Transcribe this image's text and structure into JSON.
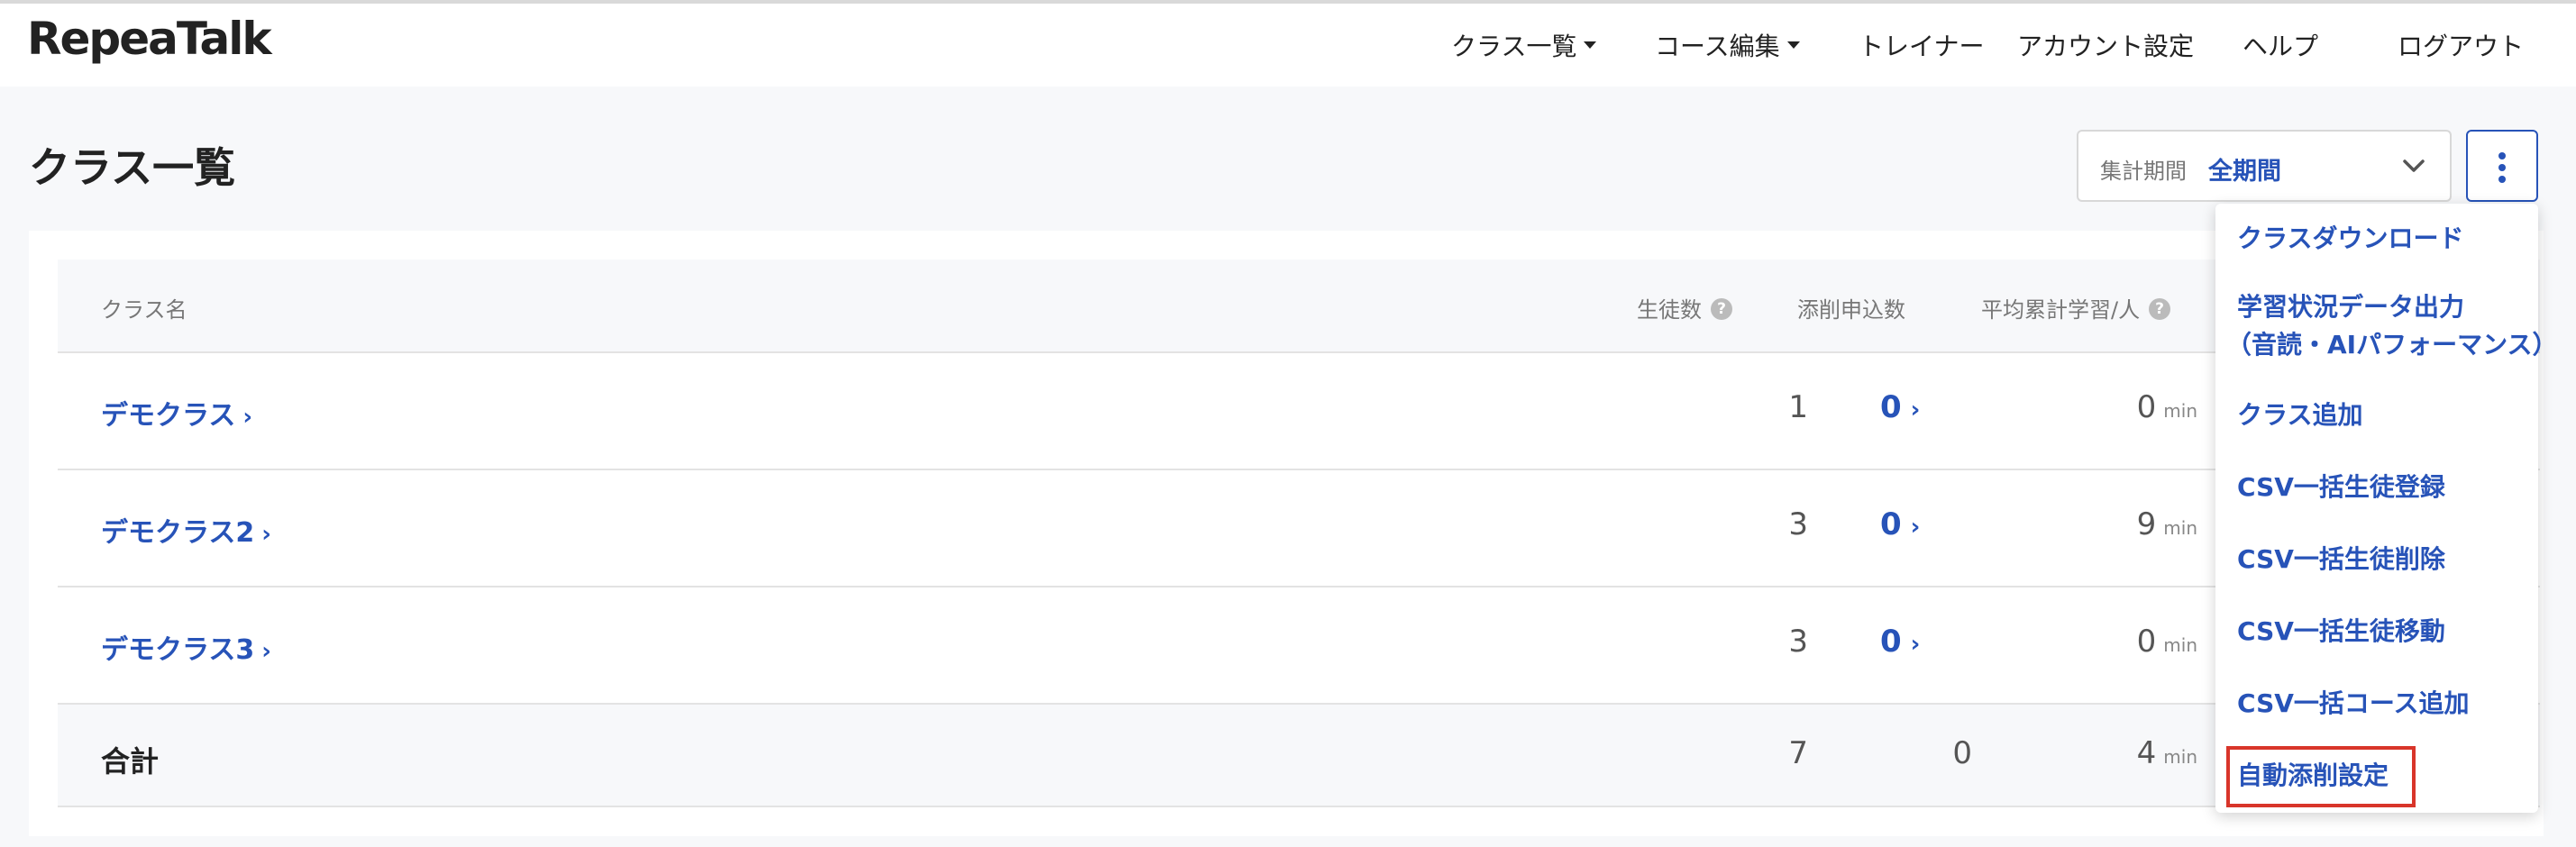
{
  "header": {
    "logo": "RepeaTalk",
    "nav": [
      {
        "label": "クラス一覧",
        "has_caret": true
      },
      {
        "label": "コース編集",
        "has_caret": true
      },
      {
        "label": "トレイナー",
        "has_caret": false
      },
      {
        "label": "アカウント設定",
        "has_caret": false
      },
      {
        "label": "ヘルプ",
        "has_caret": false
      },
      {
        "label": "ログアウト",
        "has_caret": false
      }
    ]
  },
  "page": {
    "title": "クラス一覧",
    "period_label": "集計期間",
    "period_value": "全期間"
  },
  "table": {
    "headers": {
      "class_name": "クラス名",
      "students": "生徒数",
      "correction_requests": "添削申込数",
      "avg_study": "平均累計学習/人",
      "help_mark": "?"
    },
    "rows": [
      {
        "name": "デモクラス",
        "students": "1",
        "requests": "0",
        "avg": "0",
        "unit": "min"
      },
      {
        "name": "デモクラス2",
        "students": "3",
        "requests": "0",
        "avg": "9",
        "unit": "min"
      },
      {
        "name": "デモクラス3",
        "students": "3",
        "requests": "0",
        "avg": "0",
        "unit": "min"
      }
    ],
    "total": {
      "label": "合計",
      "students": "7",
      "requests": "0",
      "avg": "4",
      "unit": "min"
    }
  },
  "menu": {
    "items": [
      "クラスダウンロード",
      "学習状況データ出力",
      "（音読・AIパフォーマンス）",
      "クラス追加",
      "CSV一括生徒登録",
      "CSV一括生徒削除",
      "CSV一括生徒移動",
      "CSV一括コース追加",
      "自動添削設定"
    ]
  },
  "icons": {
    "chevron_link": "chevron-right-icon",
    "more": "vertical-ellipsis-icon",
    "select": "chevron-down-icon"
  },
  "colors": {
    "accent": "#2753b8",
    "highlight": "#d8352a"
  }
}
